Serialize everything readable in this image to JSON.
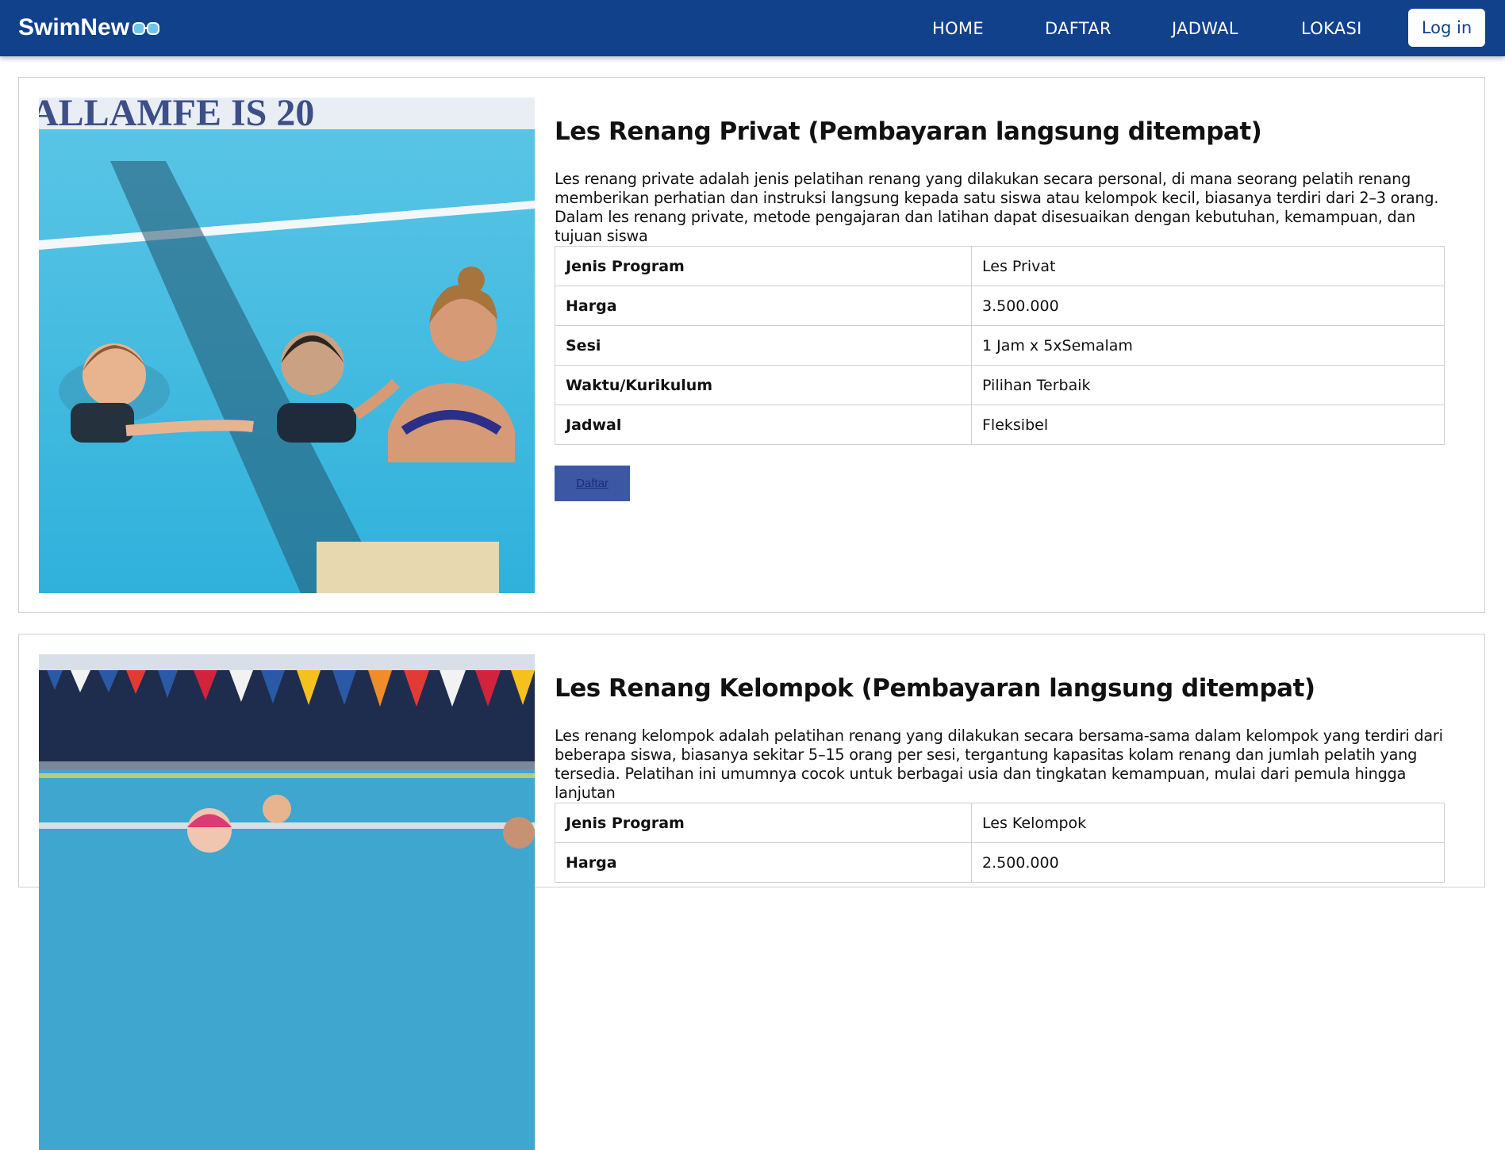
{
  "nav": {
    "brand": "SwimNew",
    "links": [
      "HOME",
      "DAFTAR",
      "JADWAL",
      "LOKASI"
    ],
    "login": "Log in"
  },
  "programs": [
    {
      "title": "Les Renang Privat (Pembayaran langsung ditempat)",
      "description": "Les renang private adalah jenis pelatihan renang yang dilakukan secara personal, di mana seorang pelatih renang memberikan perhatian dan instruksi langsung kepada satu siswa atau kelompok kecil, biasanya terdiri dari 2–3 orang. Dalam les renang private, metode pengajaran dan latihan dapat disesuaikan dengan kebutuhan, kemampuan, dan tujuan siswa",
      "rows": [
        {
          "key": "Jenis Program",
          "value": "Les Privat"
        },
        {
          "key": "Harga",
          "value": "3.500.000"
        },
        {
          "key": "Sesi",
          "value": "1 Jam x 5xSemalam"
        },
        {
          "key": "Waktu/Kurikulum",
          "value": "Pilihan Terbaik"
        },
        {
          "key": "Jadwal",
          "value": "Fleksibel"
        }
      ],
      "button": "Daftar"
    },
    {
      "title": "Les Renang Kelompok (Pembayaran langsung ditempat)",
      "description": "Les renang kelompok adalah pelatihan renang yang dilakukan secara bersama-sama dalam kelompok yang terdiri dari beberapa siswa, biasanya sekitar 5–15 orang per sesi, tergantung kapasitas kolam renang dan jumlah pelatih yang tersedia. Pelatihan ini umumnya cocok untuk berbagai usia dan tingkatan kemampuan, mulai dari pemula hingga lanjutan",
      "rows": [
        {
          "key": "Jenis Program",
          "value": "Les Kelompok"
        },
        {
          "key": "Harga",
          "value": "2.500.000"
        }
      ]
    }
  ]
}
